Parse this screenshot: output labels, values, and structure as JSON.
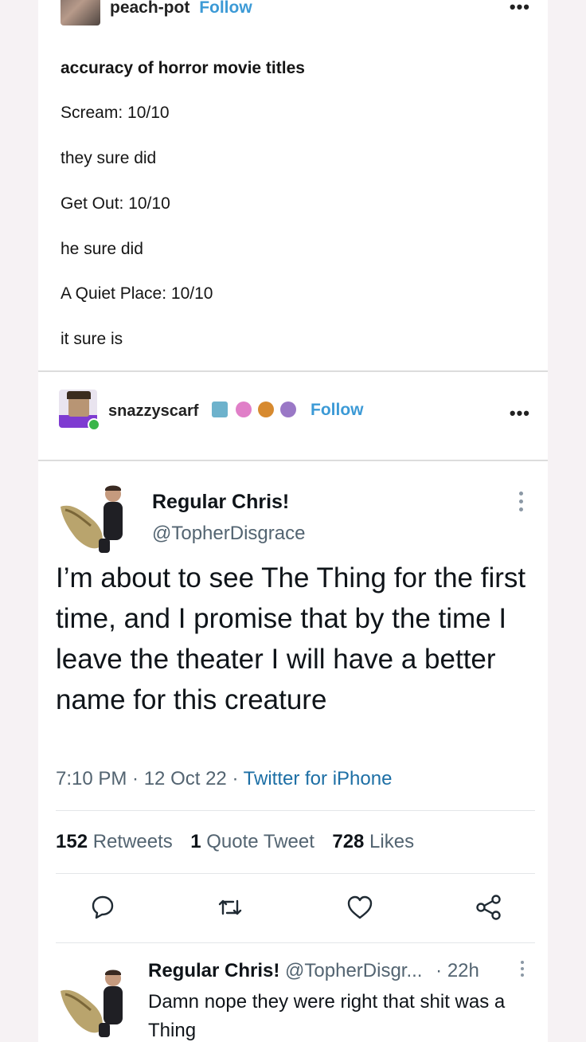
{
  "post1": {
    "username": "peach-pot",
    "follow_label": "Follow",
    "lines": [
      "accuracy of horror movie titles",
      "Scream: 10/10",
      "they sure did",
      "Get Out: 10/10",
      "he sure did",
      "A Quiet Place: 10/10",
      "it sure is"
    ]
  },
  "post2": {
    "username": "snazzyscarf",
    "follow_label": "Follow",
    "badge_icons": [
      "ticket-badge-icon",
      "pink-badge-icon",
      "paw-badge-icon",
      "camera-badge-icon"
    ]
  },
  "tweet": {
    "display_name": "Regular Chris!",
    "handle": "@TopherDisgrace",
    "text": "I’m about to see The Thing for the first time, and I promise that by the time I leave the theater I will have a better name for this creature",
    "time": "7:10 PM · 12 Oct 22 · ",
    "source": "Twitter for iPhone",
    "stats": {
      "retweets_count": "152",
      "retweets_label": " Retweets",
      "quotes_count": "1",
      "quotes_label": " Quote Tweet",
      "likes_count": "728",
      "likes_label": " Likes"
    },
    "actions": [
      "reply-icon",
      "retweet-icon",
      "like-icon",
      "share-icon"
    ]
  },
  "reply": {
    "display_name": "Regular Chris!",
    "handle": "@TopherDisgr...",
    "age": "· 22h",
    "text": "Damn nope they were right that shit was a Thing"
  },
  "colors": {
    "follow": "#3c9ad6",
    "twitter_link": "#1d6fa5",
    "muted": "#536471"
  }
}
